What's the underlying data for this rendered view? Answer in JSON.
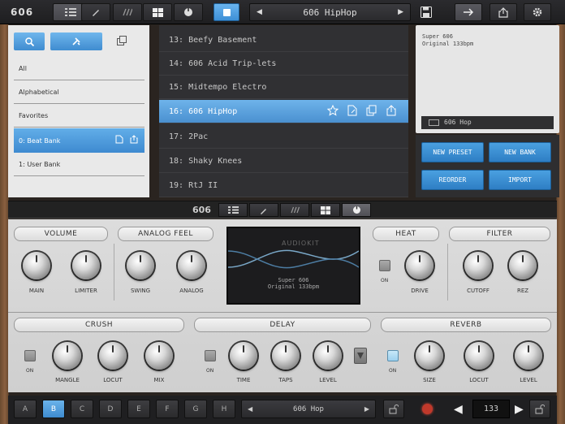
{
  "app": {
    "logo": "606"
  },
  "toolbar": {
    "preset_name": "606 HipHop",
    "prev_glyph": "◀",
    "next_glyph": "▶"
  },
  "library": {
    "items": [
      {
        "label": "All"
      },
      {
        "label": "Alphabetical"
      },
      {
        "label": "Favorites"
      },
      {
        "label": "0: Beat Bank",
        "selected": true
      },
      {
        "label": "1: User Bank"
      }
    ]
  },
  "presets": [
    {
      "label": "13: Beefy Basement"
    },
    {
      "label": "14: 606 Acid Trip-lets"
    },
    {
      "label": "15: Midtempo Electro"
    },
    {
      "label": "16: 606 HipHop",
      "selected": true
    },
    {
      "label": "17: 2Pac"
    },
    {
      "label": "18: Shaky Knees"
    },
    {
      "label": "19: RtJ II"
    }
  ],
  "info": {
    "line1": "Super 606",
    "line2": "Original 133bpm",
    "bar_label": "606 Hop"
  },
  "actions": {
    "new_preset": "NEW PRESET",
    "new_bank": "NEW BANK",
    "reorder": "REORDER",
    "import": "IMPORT"
  },
  "midbar": {
    "logo": "606"
  },
  "synth": {
    "sections": {
      "volume": "VOLUME",
      "analog_feel": "ANALOG FEEL",
      "heat": "HEAT",
      "filter": "FILTER",
      "crush": "CRUSH",
      "delay": "DELAY",
      "reverb": "REVERB"
    },
    "knobs": {
      "main": "MAIN",
      "limiter": "LIMITER",
      "swing": "SWING",
      "analog": "ANALOG",
      "drive": "DRIVE",
      "cutoff": "CUTOFF",
      "rez": "REZ",
      "mangle": "MANGLE",
      "crush_locut": "LOCUT",
      "mix": "MIX",
      "time": "TIME",
      "taps": "TAPS",
      "delay_level": "LEVEL",
      "size": "SIZE",
      "reverb_locut": "LOCUT",
      "reverb_level": "LEVEL"
    },
    "on_label": "ON",
    "scope": {
      "watermark": "AUDIOKIT",
      "line1": "Super 606",
      "line2": "Original 133bpm"
    }
  },
  "bottombar": {
    "pads": [
      "A",
      "B",
      "C",
      "D",
      "E",
      "F",
      "G",
      "H"
    ],
    "selected_pad": "B",
    "preset_name": "606 Hop",
    "tempo": "133"
  },
  "colors": {
    "accent": "#4a90d0",
    "record": "#c0392b"
  }
}
